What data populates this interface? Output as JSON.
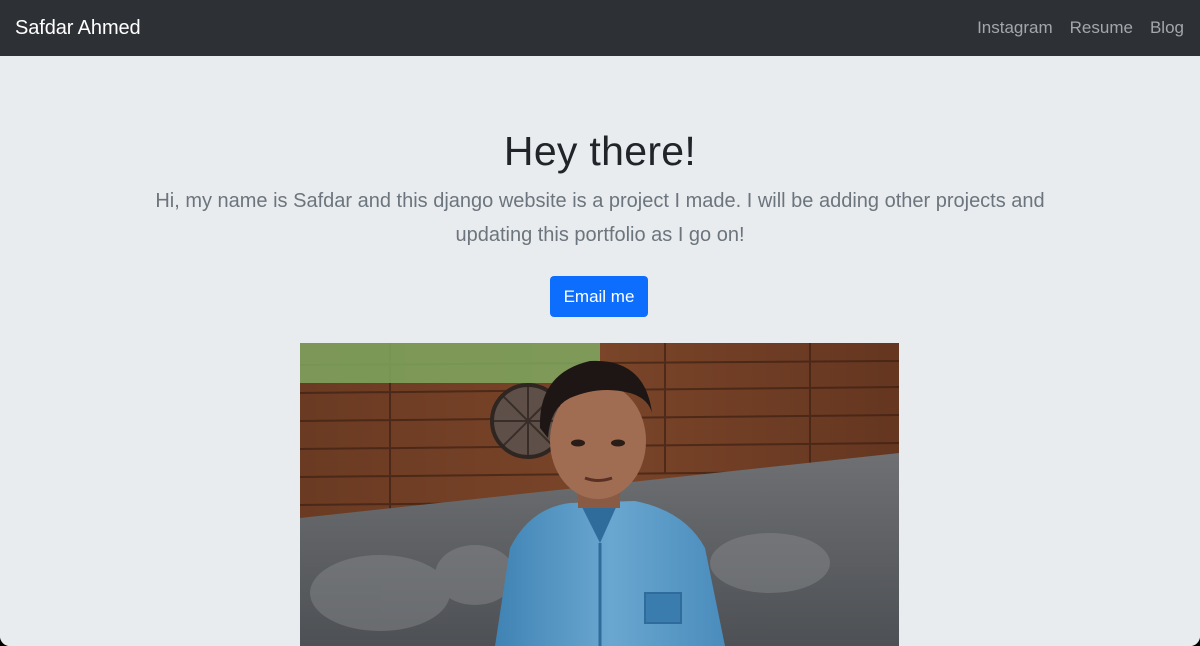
{
  "navbar": {
    "brand": "Safdar Ahmed",
    "links": [
      {
        "label": "Instagram"
      },
      {
        "label": "Resume"
      },
      {
        "label": "Blog"
      }
    ]
  },
  "hero": {
    "heading": "Hey there!",
    "lead": "Hi, my name is Safdar and this django website is a project I made. I will be adding other projects and updating this portfolio as I go on!",
    "button_label": "Email me"
  },
  "photo": {
    "subject": "portrait of a young man in a denim shirt"
  },
  "colors": {
    "navbar_bg": "#2d3136",
    "page_bg": "#e9ecef",
    "primary": "#0d6efd",
    "heading": "#212529",
    "muted": "#6c757d"
  }
}
